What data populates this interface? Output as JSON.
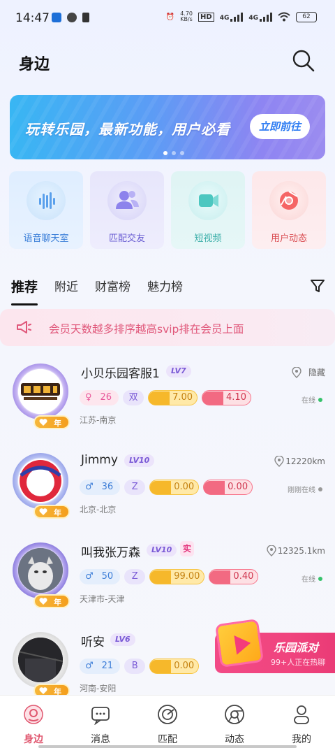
{
  "status_bar": {
    "time": "14:47",
    "net_speed": "4.70\nKB/s",
    "network": [
      "HD",
      "4G",
      "4G"
    ],
    "battery": "62"
  },
  "header": {
    "title": "身边"
  },
  "banner": {
    "text": "玩转乐园，最新功能，用户必看",
    "cta": "立即前往",
    "dots": 3,
    "active_dot": 0
  },
  "features": [
    {
      "label": "语音聊天室",
      "icon": "voice-wave-icon"
    },
    {
      "label": "匹配交友",
      "icon": "users-icon"
    },
    {
      "label": "短视频",
      "icon": "video-camera-icon"
    },
    {
      "label": "用户动态",
      "icon": "chrome-swirl-icon"
    }
  ],
  "tabs": {
    "items": [
      "推荐",
      "附近",
      "财富榜",
      "魅力榜"
    ],
    "active": "推荐"
  },
  "notice": {
    "text": "会员天数越多排序越高svip排在会员上面"
  },
  "users": [
    {
      "name": "小贝乐园客服1",
      "level": "LV7",
      "location": "隐藏",
      "gender": "♀",
      "age": "26",
      "zodiac": "双",
      "wealth": "7.00",
      "charm": "4.10",
      "status": "在线",
      "city": "江苏-南京",
      "year_badge": "年"
    },
    {
      "name": "Jimmy",
      "level": "LV10",
      "location": "12220km",
      "gender": "♂",
      "age": "36",
      "zodiac": "Z",
      "wealth": "0.00",
      "charm": "0.00",
      "status": "刚刚在线",
      "city": "北京-北京",
      "year_badge": "年"
    },
    {
      "name": "叫我张万森",
      "level": "LV10",
      "verified": "实",
      "location": "12325.1km",
      "gender": "♂",
      "age": "50",
      "zodiac": "Z",
      "wealth": "99.00",
      "charm": "0.40",
      "status": "在线",
      "city": "天津市-天津",
      "year_badge": "年"
    },
    {
      "name": "听安",
      "level": "LV6",
      "location": "",
      "gender": "♂",
      "age": "21",
      "zodiac": "B",
      "wealth": "0.00",
      "charm": "",
      "status": "",
      "city": "河南-安阳",
      "year_badge": "年"
    }
  ],
  "party": {
    "title": "乐园派对",
    "subtitle": "99+人正在热聊"
  },
  "bottom_nav": [
    {
      "label": "身边",
      "active": true
    },
    {
      "label": "消息",
      "active": false
    },
    {
      "label": "匹配",
      "active": false
    },
    {
      "label": "动态",
      "active": false
    },
    {
      "label": "我的",
      "active": false
    }
  ],
  "colors": {
    "accent": "#e0576f",
    "banner_from": "#38b6f3",
    "banner_to": "#9b8cf0",
    "notice_text": "#e0577a",
    "online": "#36c26b"
  }
}
